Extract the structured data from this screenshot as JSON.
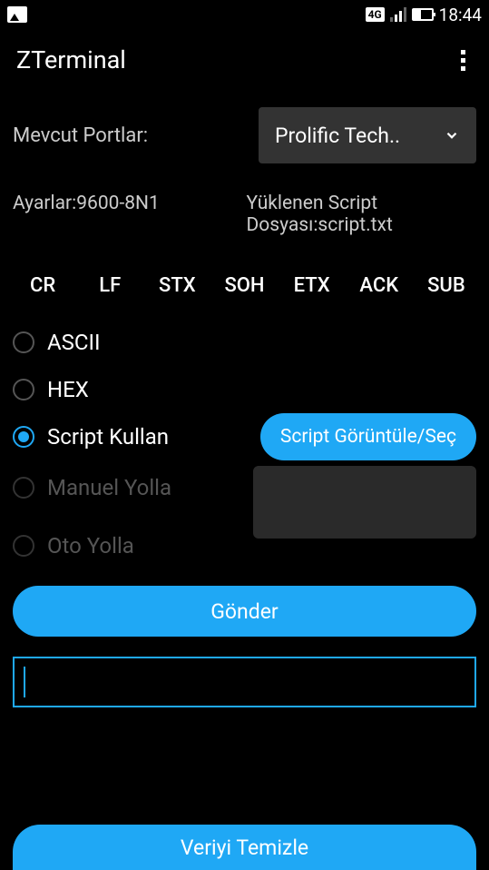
{
  "status": {
    "network": "4G",
    "time": "18:44"
  },
  "app": {
    "title": "ZTerminal"
  },
  "ports": {
    "label": "Mevcut Portlar:",
    "selected": "Prolific Tech.."
  },
  "settings": {
    "config": "Ayarlar:9600-8N1",
    "script_loaded": "Yüklenen Script Dosyası:script.txt"
  },
  "control_chars": [
    "CR",
    "LF",
    "STX",
    "SOH",
    "ETX",
    "ACK",
    "SUB"
  ],
  "modes": {
    "ascii": "ASCII",
    "hex": "HEX",
    "script": "Script Kullan",
    "manual": "Manuel Yolla",
    "auto": "Oto Yolla"
  },
  "buttons": {
    "view_script": "Script Görüntüle/Seç",
    "send": "Gönder",
    "clear": "Veriyi Temizle"
  },
  "input": {
    "value": ""
  }
}
